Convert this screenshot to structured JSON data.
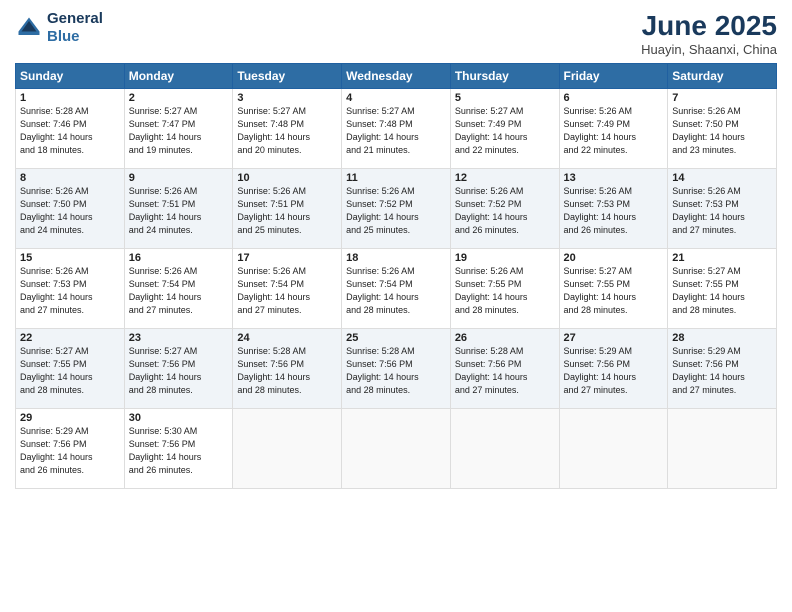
{
  "logo": {
    "line1": "General",
    "line2": "Blue"
  },
  "title": "June 2025",
  "location": "Huayin, Shaanxi, China",
  "weekdays": [
    "Sunday",
    "Monday",
    "Tuesday",
    "Wednesday",
    "Thursday",
    "Friday",
    "Saturday"
  ],
  "weeks": [
    [
      {
        "day": "1",
        "info": "Sunrise: 5:28 AM\nSunset: 7:46 PM\nDaylight: 14 hours\nand 18 minutes."
      },
      {
        "day": "2",
        "info": "Sunrise: 5:27 AM\nSunset: 7:47 PM\nDaylight: 14 hours\nand 19 minutes."
      },
      {
        "day": "3",
        "info": "Sunrise: 5:27 AM\nSunset: 7:48 PM\nDaylight: 14 hours\nand 20 minutes."
      },
      {
        "day": "4",
        "info": "Sunrise: 5:27 AM\nSunset: 7:48 PM\nDaylight: 14 hours\nand 21 minutes."
      },
      {
        "day": "5",
        "info": "Sunrise: 5:27 AM\nSunset: 7:49 PM\nDaylight: 14 hours\nand 22 minutes."
      },
      {
        "day": "6",
        "info": "Sunrise: 5:26 AM\nSunset: 7:49 PM\nDaylight: 14 hours\nand 22 minutes."
      },
      {
        "day": "7",
        "info": "Sunrise: 5:26 AM\nSunset: 7:50 PM\nDaylight: 14 hours\nand 23 minutes."
      }
    ],
    [
      {
        "day": "8",
        "info": "Sunrise: 5:26 AM\nSunset: 7:50 PM\nDaylight: 14 hours\nand 24 minutes."
      },
      {
        "day": "9",
        "info": "Sunrise: 5:26 AM\nSunset: 7:51 PM\nDaylight: 14 hours\nand 24 minutes."
      },
      {
        "day": "10",
        "info": "Sunrise: 5:26 AM\nSunset: 7:51 PM\nDaylight: 14 hours\nand 25 minutes."
      },
      {
        "day": "11",
        "info": "Sunrise: 5:26 AM\nSunset: 7:52 PM\nDaylight: 14 hours\nand 25 minutes."
      },
      {
        "day": "12",
        "info": "Sunrise: 5:26 AM\nSunset: 7:52 PM\nDaylight: 14 hours\nand 26 minutes."
      },
      {
        "day": "13",
        "info": "Sunrise: 5:26 AM\nSunset: 7:53 PM\nDaylight: 14 hours\nand 26 minutes."
      },
      {
        "day": "14",
        "info": "Sunrise: 5:26 AM\nSunset: 7:53 PM\nDaylight: 14 hours\nand 27 minutes."
      }
    ],
    [
      {
        "day": "15",
        "info": "Sunrise: 5:26 AM\nSunset: 7:53 PM\nDaylight: 14 hours\nand 27 minutes."
      },
      {
        "day": "16",
        "info": "Sunrise: 5:26 AM\nSunset: 7:54 PM\nDaylight: 14 hours\nand 27 minutes."
      },
      {
        "day": "17",
        "info": "Sunrise: 5:26 AM\nSunset: 7:54 PM\nDaylight: 14 hours\nand 27 minutes."
      },
      {
        "day": "18",
        "info": "Sunrise: 5:26 AM\nSunset: 7:54 PM\nDaylight: 14 hours\nand 28 minutes."
      },
      {
        "day": "19",
        "info": "Sunrise: 5:26 AM\nSunset: 7:55 PM\nDaylight: 14 hours\nand 28 minutes."
      },
      {
        "day": "20",
        "info": "Sunrise: 5:27 AM\nSunset: 7:55 PM\nDaylight: 14 hours\nand 28 minutes."
      },
      {
        "day": "21",
        "info": "Sunrise: 5:27 AM\nSunset: 7:55 PM\nDaylight: 14 hours\nand 28 minutes."
      }
    ],
    [
      {
        "day": "22",
        "info": "Sunrise: 5:27 AM\nSunset: 7:55 PM\nDaylight: 14 hours\nand 28 minutes."
      },
      {
        "day": "23",
        "info": "Sunrise: 5:27 AM\nSunset: 7:56 PM\nDaylight: 14 hours\nand 28 minutes."
      },
      {
        "day": "24",
        "info": "Sunrise: 5:28 AM\nSunset: 7:56 PM\nDaylight: 14 hours\nand 28 minutes."
      },
      {
        "day": "25",
        "info": "Sunrise: 5:28 AM\nSunset: 7:56 PM\nDaylight: 14 hours\nand 28 minutes."
      },
      {
        "day": "26",
        "info": "Sunrise: 5:28 AM\nSunset: 7:56 PM\nDaylight: 14 hours\nand 27 minutes."
      },
      {
        "day": "27",
        "info": "Sunrise: 5:29 AM\nSunset: 7:56 PM\nDaylight: 14 hours\nand 27 minutes."
      },
      {
        "day": "28",
        "info": "Sunrise: 5:29 AM\nSunset: 7:56 PM\nDaylight: 14 hours\nand 27 minutes."
      }
    ],
    [
      {
        "day": "29",
        "info": "Sunrise: 5:29 AM\nSunset: 7:56 PM\nDaylight: 14 hours\nand 26 minutes."
      },
      {
        "day": "30",
        "info": "Sunrise: 5:30 AM\nSunset: 7:56 PM\nDaylight: 14 hours\nand 26 minutes."
      },
      null,
      null,
      null,
      null,
      null
    ]
  ]
}
